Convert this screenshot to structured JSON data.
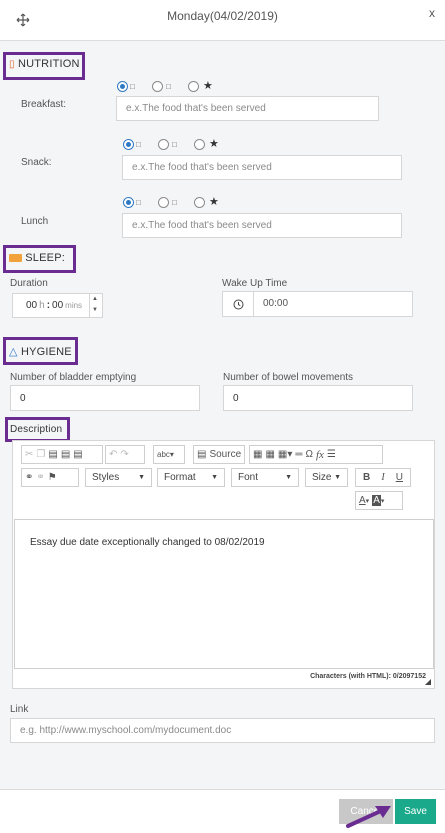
{
  "dialog": {
    "title": "Monday(04/02/2019)",
    "move_icon": "move-icon",
    "close_glyph": "x"
  },
  "nutrition": {
    "heading": "NUTRITION",
    "icon": "utensils-icon",
    "radio_glyph": "□",
    "star_glyph": "★",
    "meals": [
      {
        "label": "Breakfast:",
        "placeholder": "e.x.The food that's been served",
        "selected": 0
      },
      {
        "label": "Snack:",
        "placeholder": "e.x.The food that's been served",
        "selected": 0
      },
      {
        "label": "Lunch",
        "placeholder": "e.x.The food that's been served",
        "selected": 0
      }
    ]
  },
  "sleep": {
    "heading": "SLEEP:",
    "icon": "bed-icon",
    "duration_label": "Duration",
    "hours": "00",
    "hours_unit": "h",
    "minutes": "00",
    "minutes_unit": "mins",
    "wakeup_label": "Wake Up Time",
    "wakeup_value": "00:00",
    "clock_icon": "clock-icon"
  },
  "hygiene": {
    "heading": "HYGIENE",
    "icon": "flask-icon",
    "bladder_label": "Number of bladder emptying",
    "bladder_value": "0",
    "bowel_label": "Number of bowel movements",
    "bowel_value": "0"
  },
  "description": {
    "heading": "Description",
    "toolbar": {
      "source_label": "Source",
      "styles_label": "Styles",
      "format_label": "Format",
      "font_label": "Font",
      "size_label": "Size",
      "bold": "B",
      "italic": "I",
      "underline": "U",
      "text_color": "A",
      "bg_color": "A"
    },
    "content": "Essay due date exceptionally changed to 08/02/2019",
    "char_count": "Characters (with HTML): 0/2097152"
  },
  "link": {
    "label": "Link",
    "placeholder": "e.g. http://www.myschool.com/mydocument.doc"
  },
  "footer": {
    "cancel_label": "Cancel",
    "save_label": "Save"
  },
  "colors": {
    "accent": "#2f78c4",
    "highlight": "#6a2c91",
    "save": "#1aaa8b",
    "cancel": "#c8c8c8"
  }
}
